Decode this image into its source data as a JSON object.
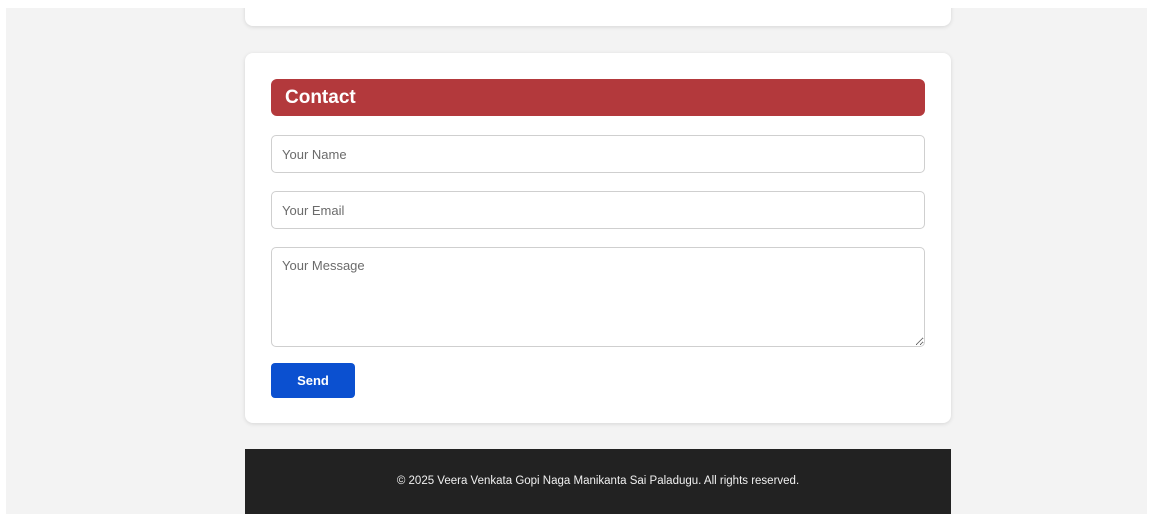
{
  "contact": {
    "title": "Contact",
    "name_placeholder": "Your Name",
    "email_placeholder": "Your Email",
    "message_placeholder": "Your Message",
    "send_label": "Send"
  },
  "footer": {
    "copyright": "© 2025 Veera Venkata Gopi Naga Manikanta Sai Paladugu. All rights reserved."
  },
  "colors": {
    "header_accent": "#b3393c",
    "send_button": "#0b50d0",
    "footer_background": "#222222",
    "page_background": "#f3f3f3"
  }
}
